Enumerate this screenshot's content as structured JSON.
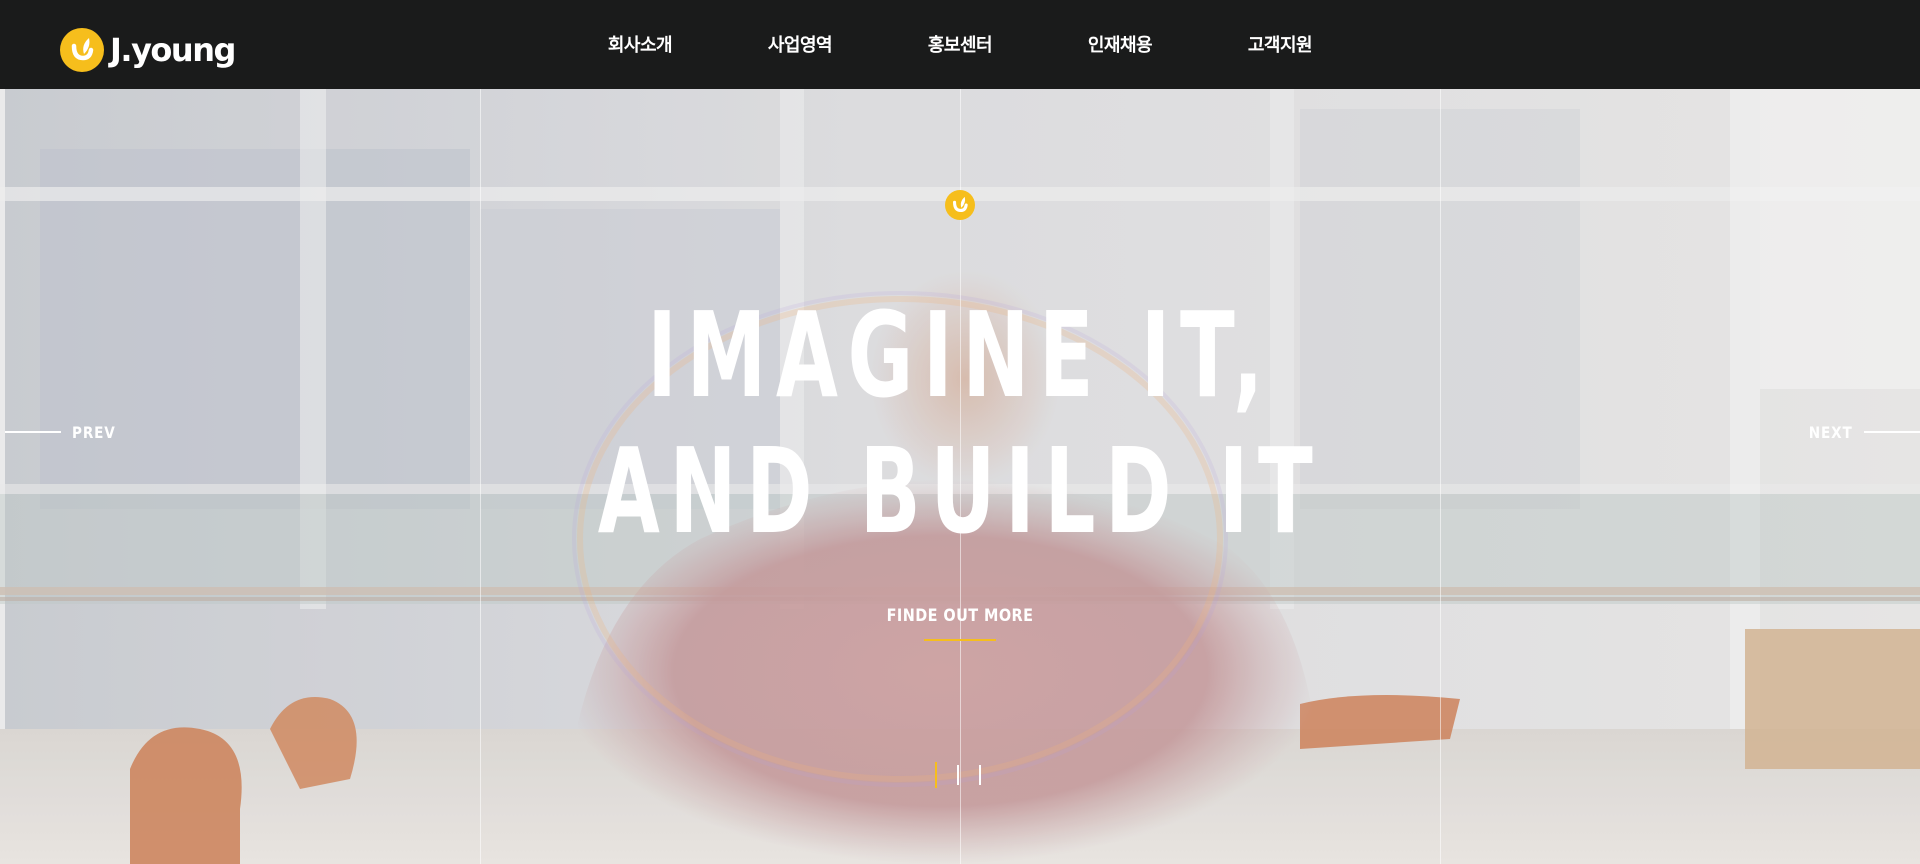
{
  "header": {
    "logo_text": "J.young",
    "logo_icon": "j-leaf-icon",
    "nav": [
      {
        "label": "회사소개"
      },
      {
        "label": "사업영역"
      },
      {
        "label": "홍보센터"
      },
      {
        "label": "인재채용"
      },
      {
        "label": "고객지원"
      }
    ]
  },
  "hero": {
    "badge_icon": "j-leaf-icon",
    "headline_line1": "IMAGINE IT,",
    "headline_line2": "AND BUILD IT",
    "cta_label": "FINDE OUT MORE",
    "prev_label": "PREV",
    "next_label": "NEXT",
    "slides": {
      "total": 3,
      "active": 1
    }
  },
  "colors": {
    "header_bg": "#1a1b1b",
    "accent": "#f6be1c",
    "text": "#ffffff"
  }
}
